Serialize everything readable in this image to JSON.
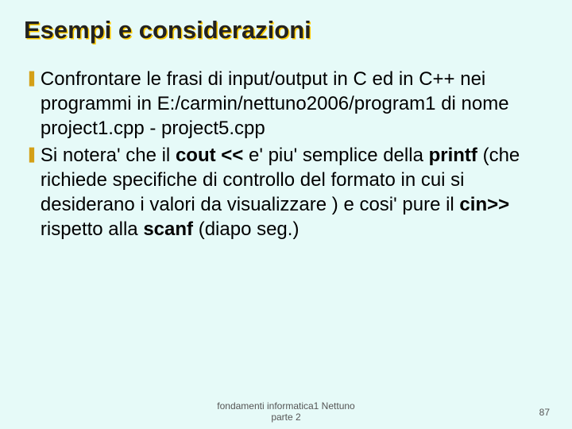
{
  "title": "Esempi e considerazioni",
  "bullets": [
    {
      "pre": "Confrontare le frasi di input/output in C ed in C++ nei programmi in E:",
      "mid": "/carmin/",
      "path": "nettuno2006/program1",
      "post1": " di nome project1.cpp - project5.cpp"
    },
    {
      "p1": "Si notera' che il ",
      "b1": "cout <<",
      "p2": " e' piu' semplice della ",
      "b2": "printf",
      "p3": " (che richiede specifiche di controllo del formato in cui si desiderano i valori da visualizzare ) e cosi' pure il ",
      "b3": "cin>>",
      "p4": " rispetto alla ",
      "b4": "scanf",
      "p5": " (diapo seg.)"
    }
  ],
  "footer": {
    "center": "fondamenti informatica1 Nettuno\nparte 2",
    "page": "87"
  }
}
